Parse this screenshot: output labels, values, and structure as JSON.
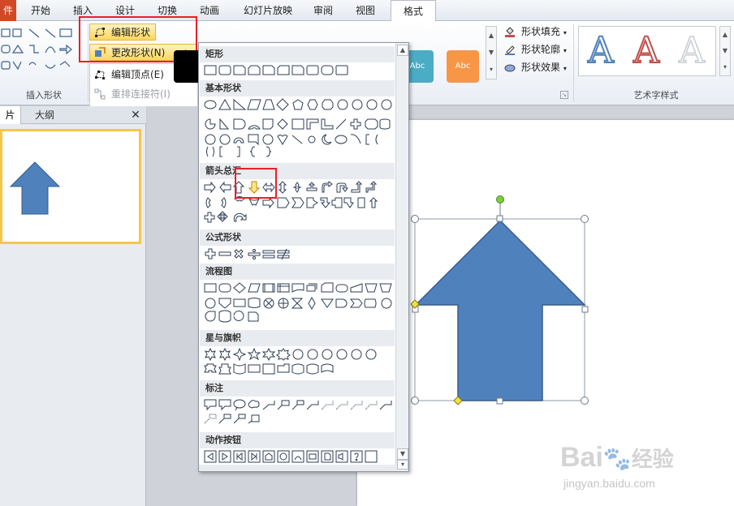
{
  "tabs": {
    "file": "件",
    "items": [
      "开始",
      "插入",
      "设计",
      "切换",
      "动画",
      "幻灯片放映",
      "审阅",
      "视图",
      "格式"
    ],
    "active": "格式"
  },
  "ribbon": {
    "insert_shapes_label": "插入形状",
    "edit_shape": "编辑形状",
    "change_shape": "更改形状(N)",
    "edit_points": "编辑顶点(E)",
    "reroute": "重排连接符(I)",
    "shape_fill": "形状填充",
    "shape_outline": "形状轮廓",
    "shape_effects": "形状效果",
    "art_label": "艺术字样式",
    "style_swatch_text": "Abc",
    "art_letter": "A"
  },
  "left_pane": {
    "tab_slides": "片",
    "tab_outline": "大纲",
    "close": "✕"
  },
  "dropdown": {
    "sections": [
      "矩形",
      "基本形状",
      "箭头总汇",
      "公式形状",
      "流程图",
      "星与旗帜",
      "标注",
      "动作按钮"
    ]
  },
  "watermark": {
    "brand": "Bai",
    "brand_cn": "经验",
    "url": "jingyan.baidu.com"
  },
  "colors": {
    "shape_blue": "#4f81bd",
    "shape_outline": "#385d8a",
    "highlight_red": "#e8202a",
    "file_tab": "#d24726"
  }
}
